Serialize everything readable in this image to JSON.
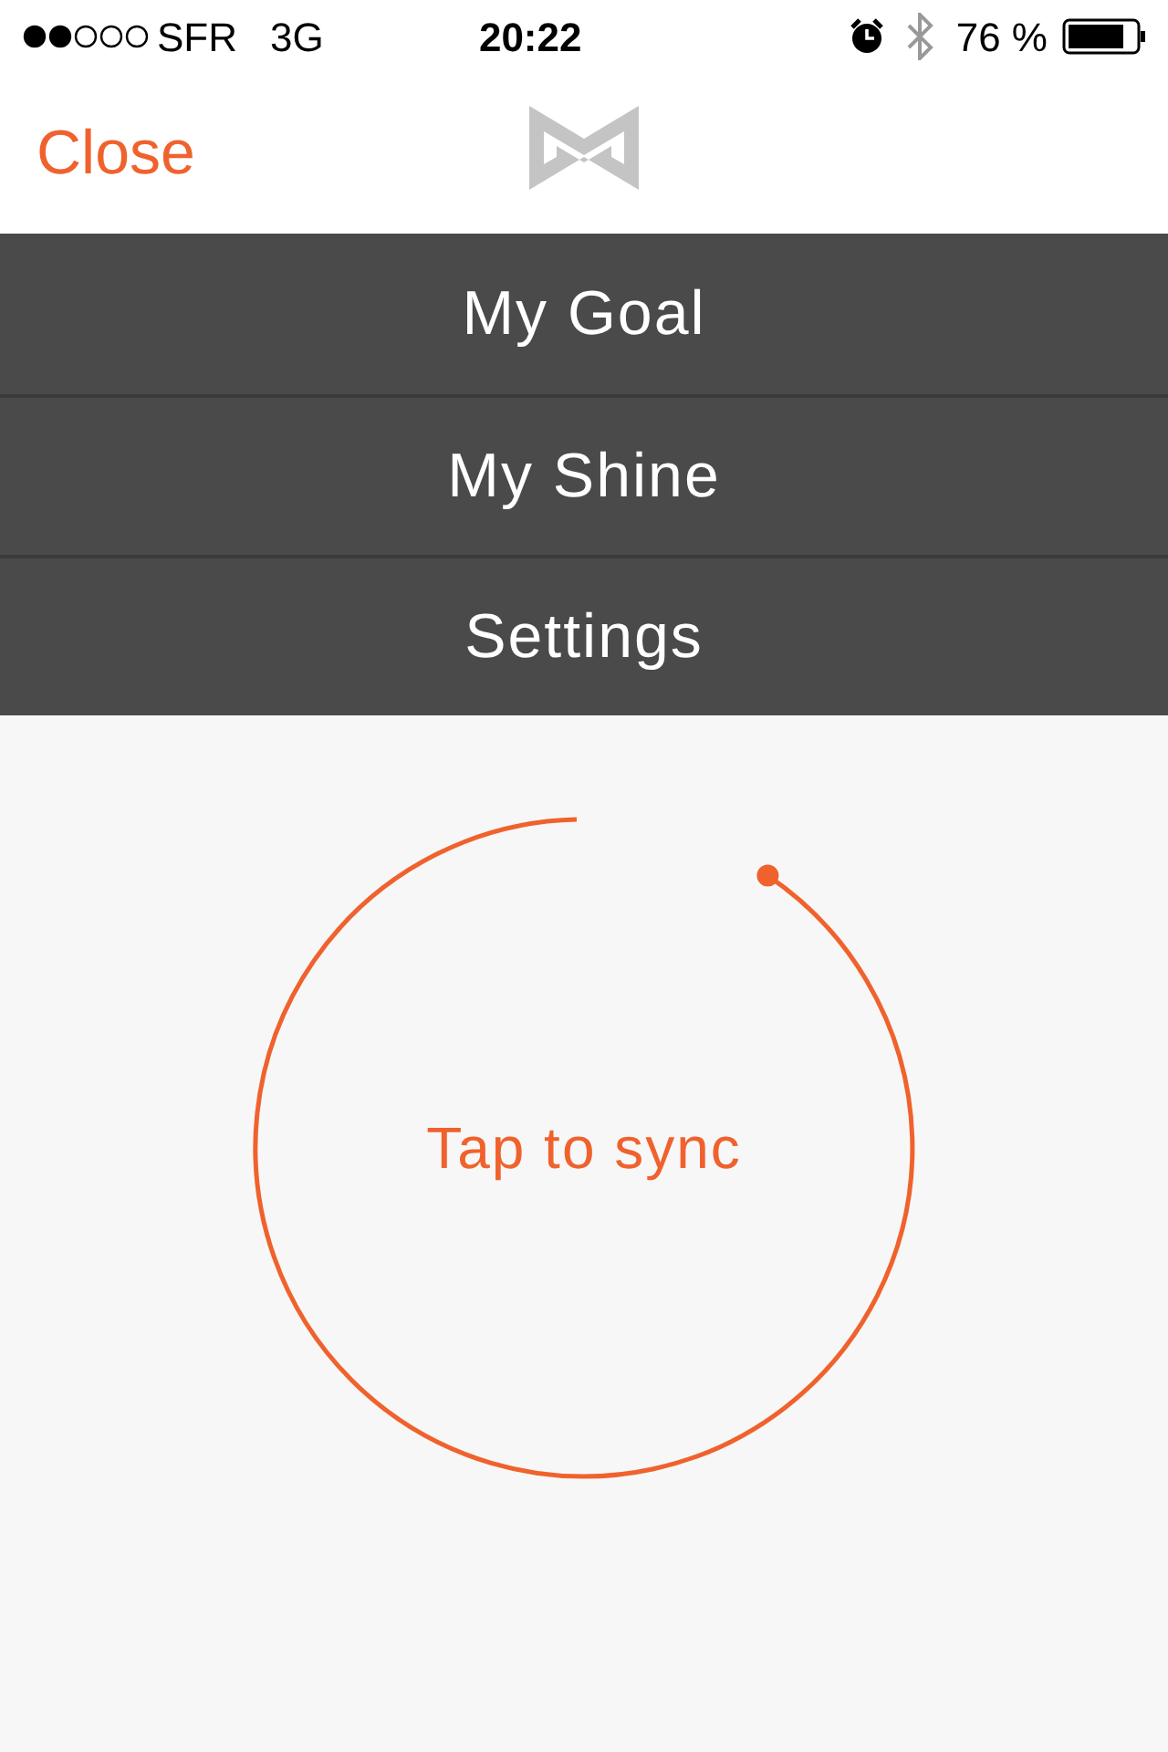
{
  "status_bar": {
    "carrier": "SFR",
    "network": "3G",
    "time": "20:22",
    "battery": "76 %"
  },
  "nav_bar": {
    "left_button": "Close"
  },
  "menu": [
    {
      "label": "My Goal"
    },
    {
      "label": "My Shine"
    },
    {
      "label": "Settings"
    }
  ],
  "sync": {
    "label": "Tap to sync"
  }
}
